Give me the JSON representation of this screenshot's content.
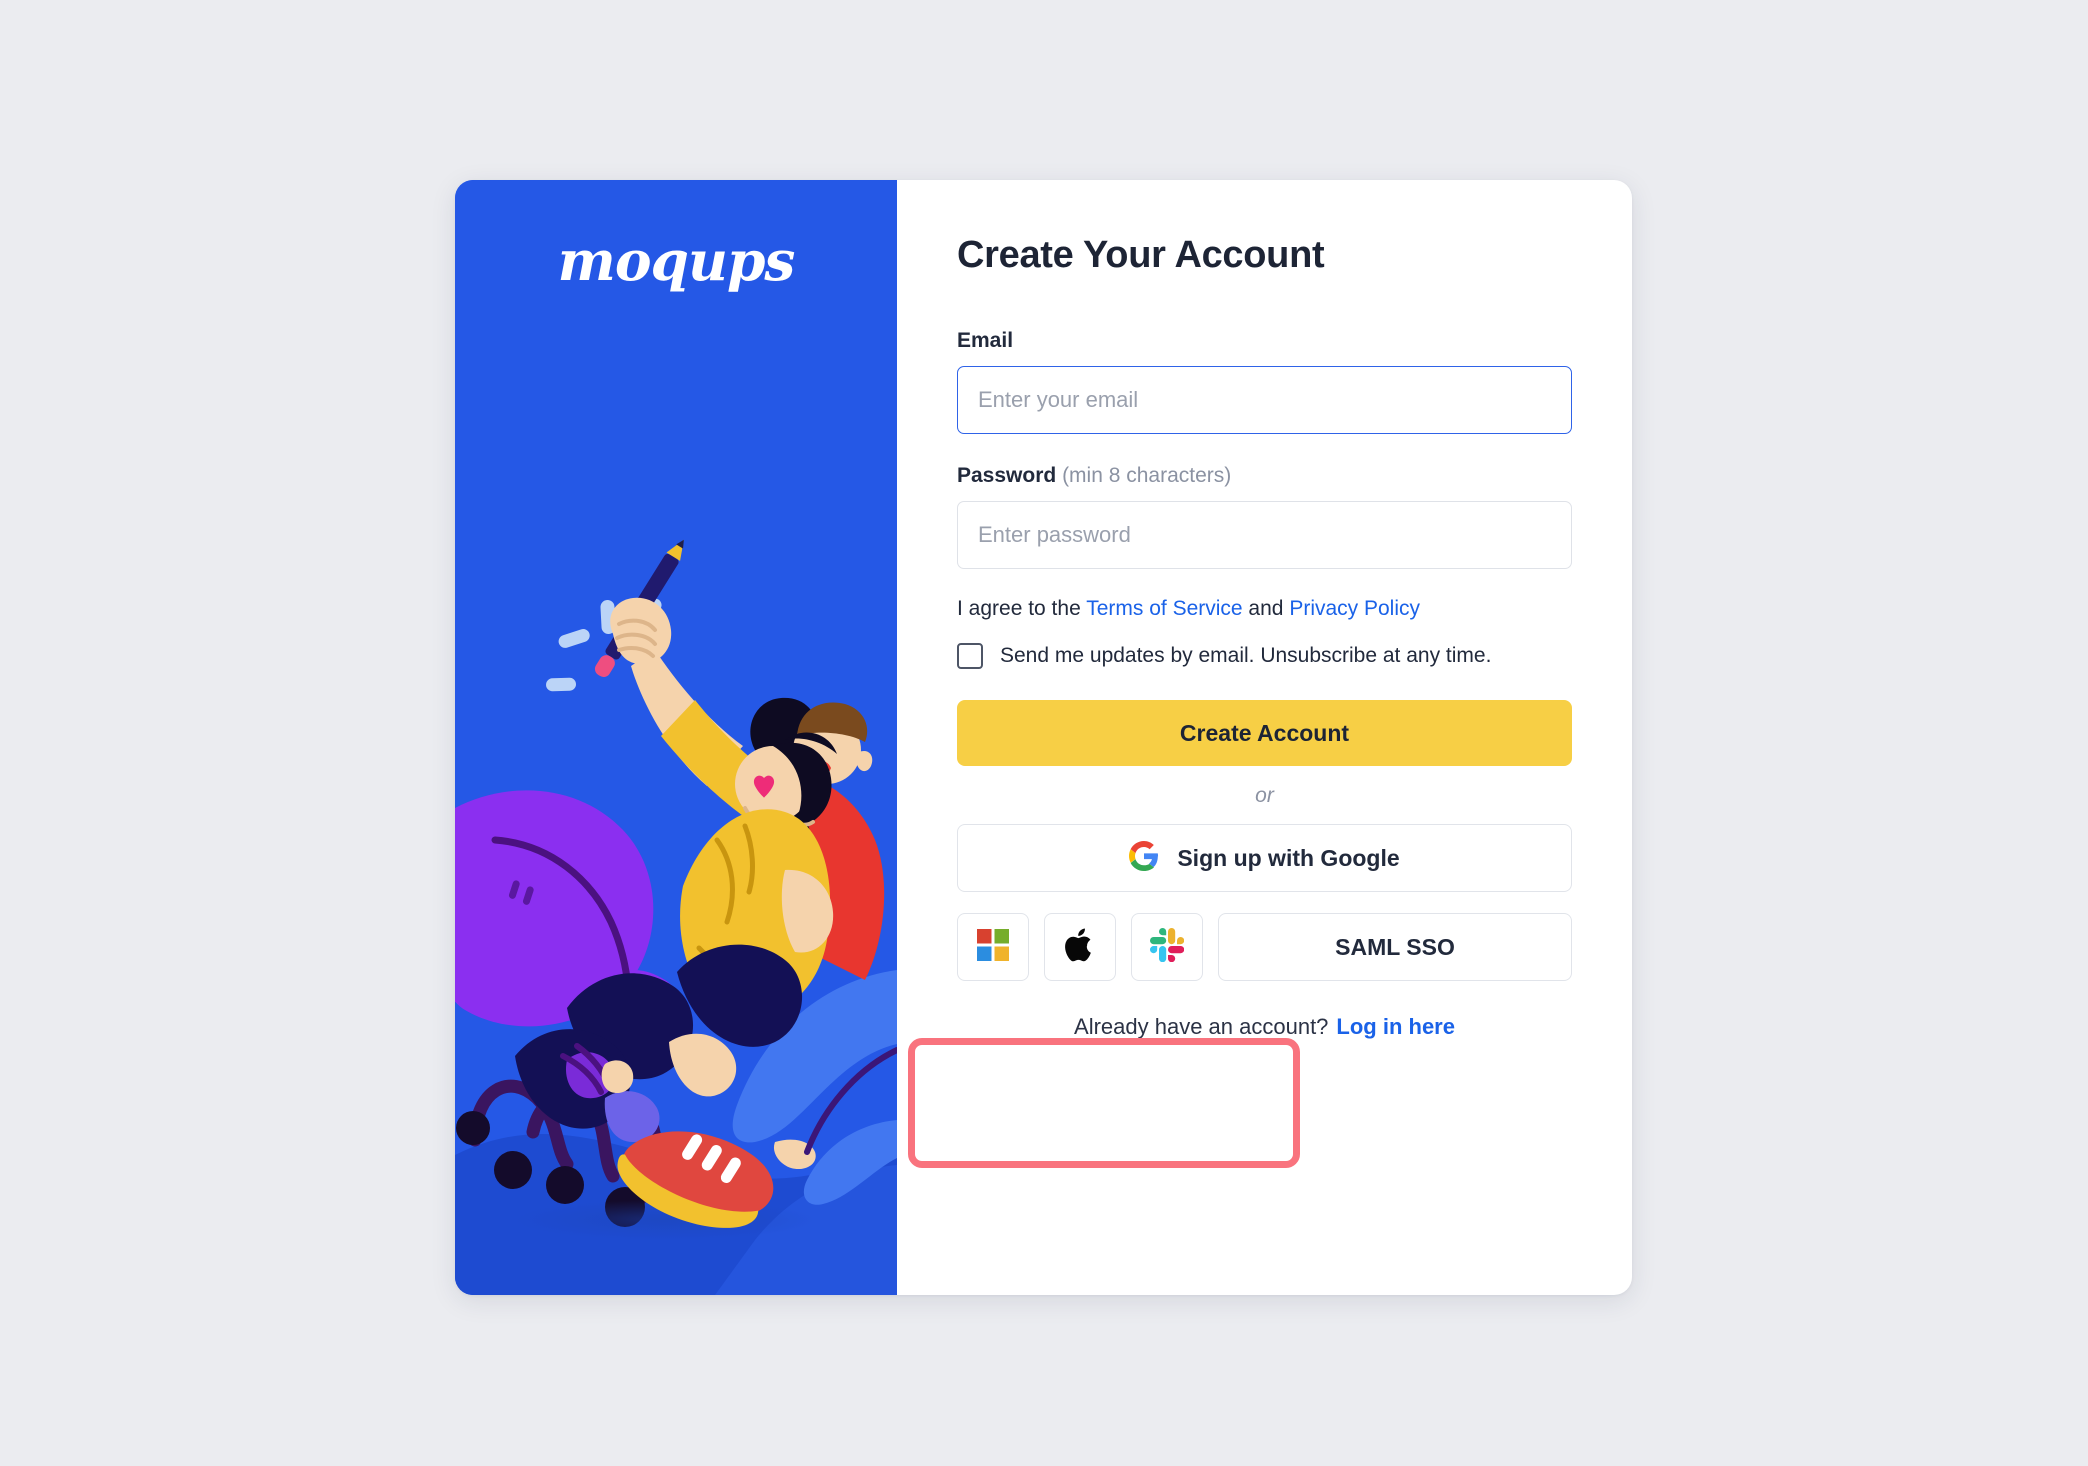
{
  "brand": {
    "logo_text": "moqups",
    "panel_color": "#2558E6",
    "illustration_name": "two-people-with-pencil-illustration"
  },
  "form": {
    "title": "Create Your Account",
    "email": {
      "label": "Email",
      "placeholder": "Enter your email",
      "value": ""
    },
    "password": {
      "label": "Password",
      "hint": "(min 8 characters)",
      "placeholder": "Enter password",
      "value": ""
    },
    "agreement": {
      "prefix": "I agree to the ",
      "terms_link": "Terms of Service",
      "middle": " and ",
      "privacy_link": "Privacy Policy"
    },
    "newsletter": {
      "label": "Send me updates by email. Unsubscribe at any time.",
      "checked": false
    },
    "submit_label": "Create Account",
    "separator_label": "or",
    "google_label": "Sign up with Google",
    "providers": [
      {
        "name": "microsoft",
        "icon": "microsoft-icon"
      },
      {
        "name": "apple",
        "icon": "apple-icon"
      },
      {
        "name": "slack",
        "icon": "slack-icon"
      }
    ],
    "saml_label": "SAML SSO",
    "footer": {
      "text": "Already have an account?",
      "link": "Log in here"
    }
  },
  "colors": {
    "accent_blue": "#2558E6",
    "primary_button": "#F7CF45",
    "link_blue": "#1a62e8",
    "highlight_red": "#F9737E",
    "page_background": "#ebecf0"
  },
  "annotation": {
    "highlight_target": "social-provider-icon-buttons",
    "highlight_color": "#F9737E"
  }
}
